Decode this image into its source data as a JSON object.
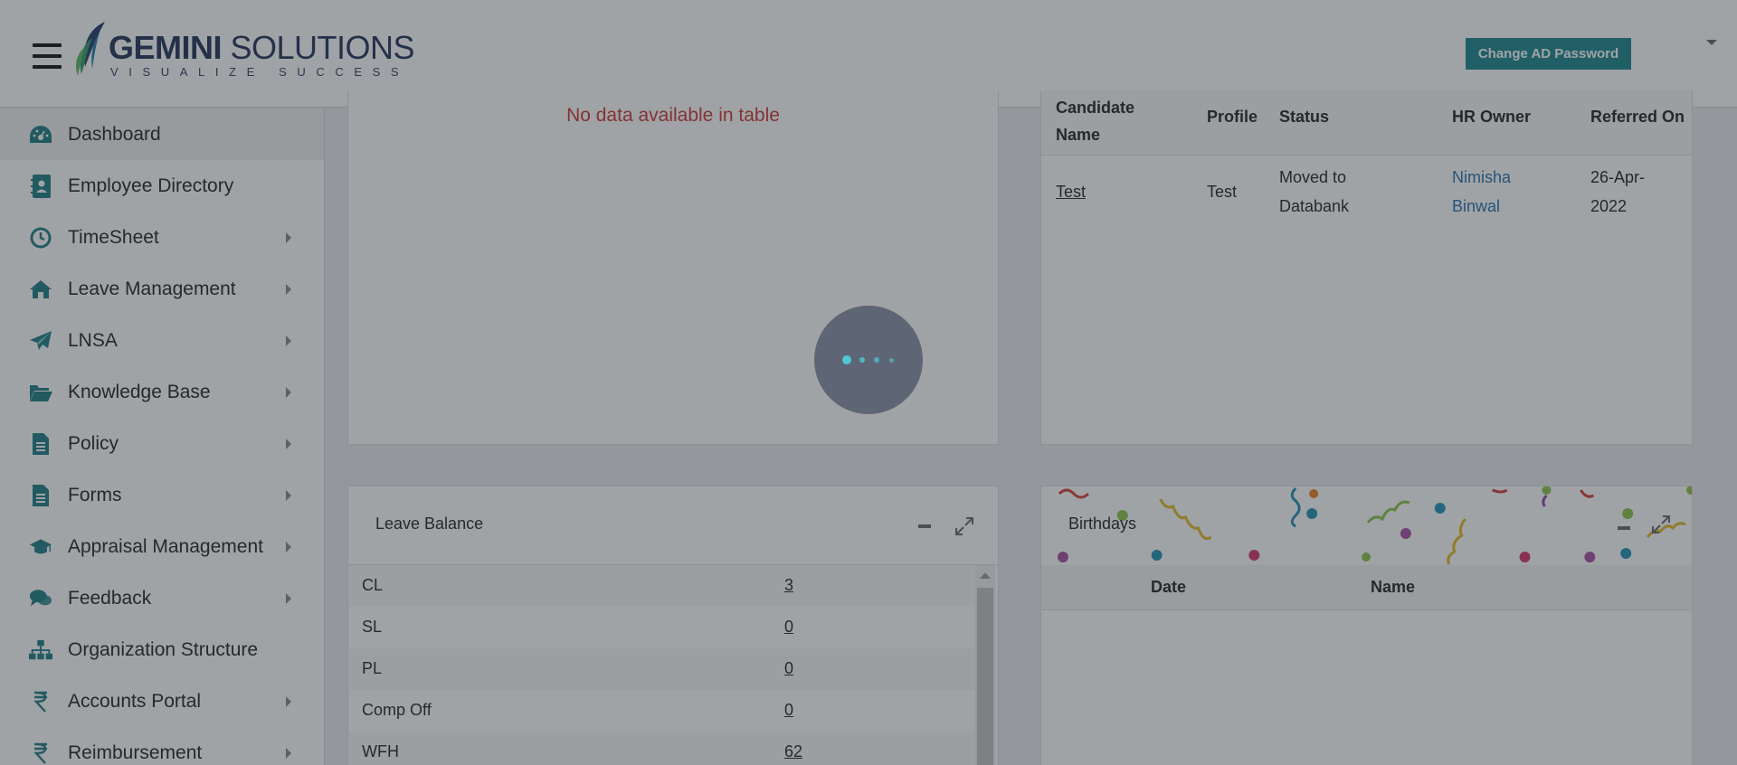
{
  "header": {
    "logo_word1": "GEMINI",
    "logo_word2": " SOLUTIONS",
    "logo_tagline": "VISUALIZE SUCCESS",
    "change_password_label": "Change AD Password"
  },
  "sidebar": {
    "items": [
      {
        "label": "Dashboard",
        "icon": "dashboard-icon",
        "has_submenu": false,
        "active": true
      },
      {
        "label": "Employee Directory",
        "icon": "address-book-icon",
        "has_submenu": false
      },
      {
        "label": "TimeSheet",
        "icon": "clock-icon",
        "has_submenu": true
      },
      {
        "label": "Leave Management",
        "icon": "home-icon",
        "has_submenu": true
      },
      {
        "label": "LNSA",
        "icon": "paper-plane-icon",
        "has_submenu": true
      },
      {
        "label": "Knowledge Base",
        "icon": "folder-open-icon",
        "has_submenu": true
      },
      {
        "label": "Policy",
        "icon": "file-text-icon",
        "has_submenu": true
      },
      {
        "label": "Forms",
        "icon": "file-text-icon",
        "has_submenu": true
      },
      {
        "label": "Appraisal Management",
        "icon": "graduation-cap-icon",
        "has_submenu": true
      },
      {
        "label": "Feedback",
        "icon": "comments-icon",
        "has_submenu": true
      },
      {
        "label": "Organization Structure",
        "icon": "sitemap-icon",
        "has_submenu": false
      },
      {
        "label": "Accounts Portal",
        "icon": "rupee-icon",
        "has_submenu": true
      },
      {
        "label": "Reimbursement",
        "icon": "rupee-icon",
        "has_submenu": true
      }
    ]
  },
  "top_left_panel": {
    "empty_message": "No data available in table"
  },
  "referrals": {
    "columns": [
      "Candidate Name",
      "Profile",
      "Status",
      "HR Owner",
      "Referred On"
    ],
    "rows": [
      {
        "candidate": "Test",
        "profile": "Test",
        "status": "Moved to Databank",
        "hr_owner": "Nimisha Binwal",
        "referred_on": "26-Apr-2022"
      }
    ]
  },
  "leave_balance": {
    "title": "Leave Balance",
    "rows": [
      {
        "type": "CL",
        "value": "3"
      },
      {
        "type": "SL",
        "value": "0"
      },
      {
        "type": "PL",
        "value": "0"
      },
      {
        "type": "Comp Off",
        "value": "0"
      },
      {
        "type": "WFH",
        "value": "62"
      }
    ]
  },
  "birthdays": {
    "title": "Birthdays",
    "columns": [
      "Date",
      "Name"
    ]
  },
  "colors": {
    "accent": "#19848f",
    "icon_teal": "#1a7a86",
    "error_text": "#cc3333",
    "link": "#1f6fb5",
    "loader_dot": "#4fc9d4"
  }
}
